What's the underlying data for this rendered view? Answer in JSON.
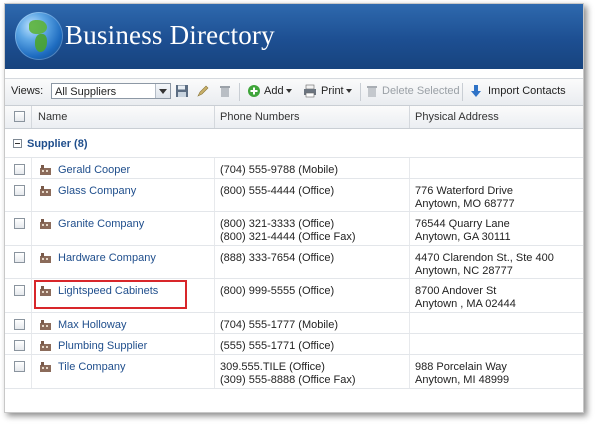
{
  "banner": {
    "title": "Business Directory"
  },
  "toolbar": {
    "views_label": "Views:",
    "views_value": "All Suppliers",
    "add_label": "Add",
    "print_label": "Print",
    "delete_selected_label": "Delete Selected",
    "import_contacts_label": "Import Contacts"
  },
  "grid": {
    "columns": {
      "name": "Name",
      "phone": "Phone Numbers",
      "address": "Physical Address"
    },
    "group_label": "Supplier (8)",
    "rows": [
      {
        "name": "Gerald Cooper",
        "phone1": "(704) 555-9788 (Mobile)",
        "phone2": "",
        "addr1": "",
        "addr2": ""
      },
      {
        "name": "Glass Company",
        "phone1": "(800) 555-4444 (Office)",
        "phone2": "",
        "addr1": "776 Waterford Drive",
        "addr2": "Anytown, MO 68777"
      },
      {
        "name": "Granite Company",
        "phone1": "(800) 321-3333 (Office)",
        "phone2": "(800) 321-4444 (Office Fax)",
        "addr1": "76544 Quarry Lane",
        "addr2": "Anytown, GA 30111"
      },
      {
        "name": "Hardware Company",
        "phone1": "(888) 333-7654 (Office)",
        "phone2": "",
        "addr1": "4470 Clarendon St., Ste 400",
        "addr2": "Anytown, NC 28777"
      },
      {
        "name": "Lightspeed Cabinets",
        "phone1": "(800) 999-5555 (Office)",
        "phone2": "",
        "addr1": "8700 Andover St",
        "addr2": "Anytown , MA 02444"
      },
      {
        "name": "Max Holloway",
        "phone1": "(704) 555-1777 (Mobile)",
        "phone2": "",
        "addr1": "",
        "addr2": ""
      },
      {
        "name": "Plumbing Supplier",
        "phone1": "(555) 555-1771 (Office)",
        "phone2": "",
        "addr1": "",
        "addr2": ""
      },
      {
        "name": "Tile Company",
        "phone1": "309.555.TILE (Office)",
        "phone2": "(309) 555-8888 (Office Fax)",
        "addr1": "988 Porcelain Way",
        "addr2": "Anytown, MI 48999"
      }
    ]
  },
  "colors": {
    "banner": "#1d4f92",
    "link": "#1f4e8c",
    "highlight": "#d8262a"
  }
}
